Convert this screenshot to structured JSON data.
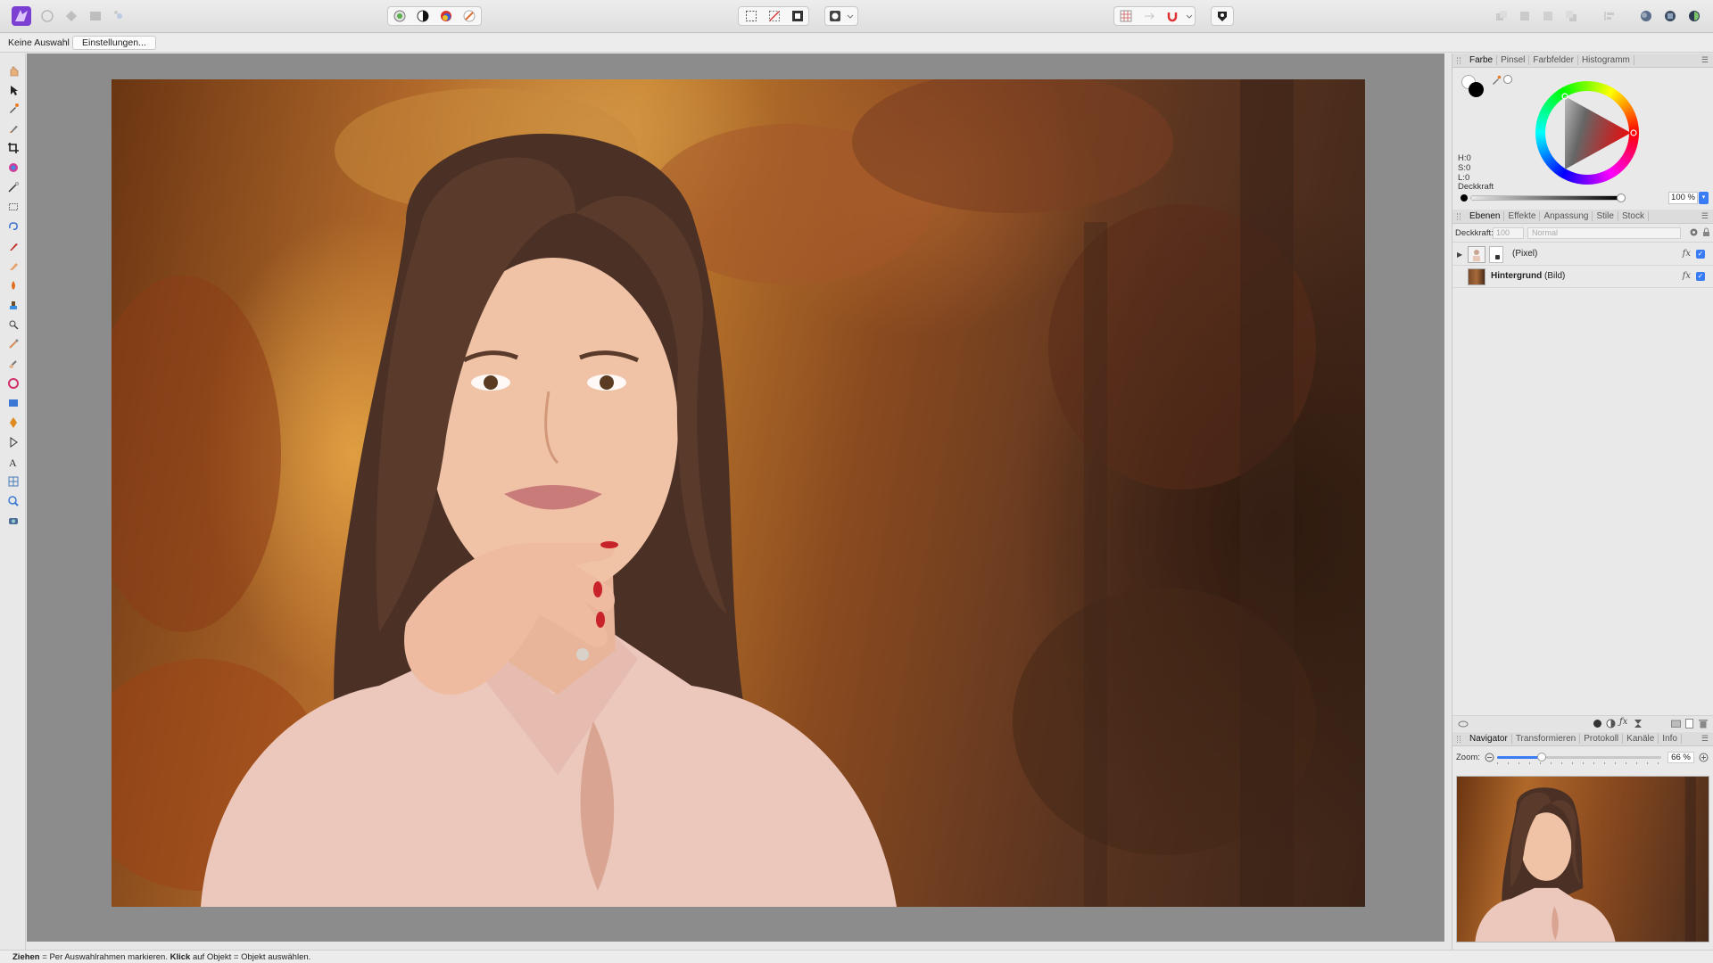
{
  "context_bar": {
    "selection_label": "Keine Auswahl",
    "settings_button": "Einstellungen..."
  },
  "color_panel": {
    "tabs": [
      "Farbe",
      "Pinsel",
      "Farbfelder",
      "Histogramm"
    ],
    "h_label": "H:",
    "h_value": "0",
    "s_label": "S:",
    "s_value": "0",
    "l_label": "L:",
    "l_value": "0",
    "opacity_label": "Deckkraft",
    "opacity_value": "100 %",
    "opacity_fraction": 1.0
  },
  "layers_panel": {
    "tabs": [
      "Ebenen",
      "Effekte",
      "Anpassung",
      "Stile",
      "Stock"
    ],
    "opacity_label": "Deckkraft:",
    "opacity_value": "100",
    "blend_mode": "Normal",
    "layers": [
      {
        "name": "(Pixel)",
        "bold": false,
        "fx": "fx"
      },
      {
        "name": "Hintergrund",
        "suffix": " (Bild)",
        "bold": true,
        "fx": "fx"
      }
    ]
  },
  "navigator_panel": {
    "tabs": [
      "Navigator",
      "Transformieren",
      "Protokoll",
      "Kanäle",
      "Info"
    ],
    "zoom_label": "Zoom:",
    "zoom_value": "66 %",
    "zoom_fraction": 0.27
  },
  "status_bar": {
    "drag_key": "Ziehen",
    "drag_text": " = Per Auswahlrahmen markieren. ",
    "click_key": "Klick",
    "click_text": " auf Objekt = Objekt auswählen."
  },
  "colors": {
    "accent": "#3a7cf6",
    "canvas_bg": "#8c8c8c",
    "panel_bg": "#e9e9e9"
  }
}
